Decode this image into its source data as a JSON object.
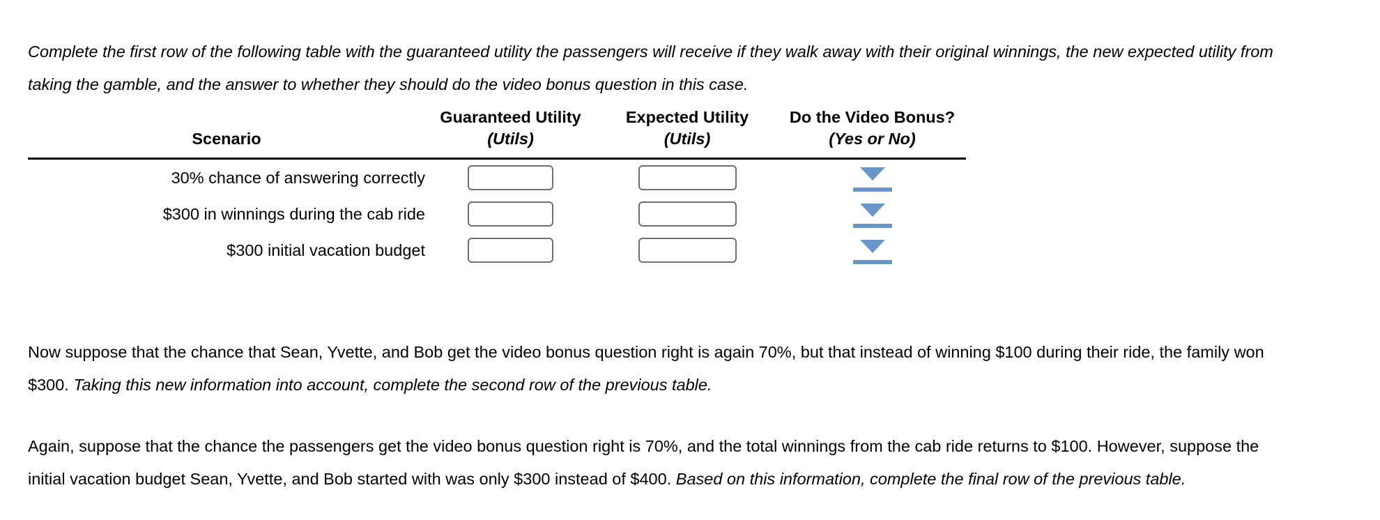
{
  "document": {
    "intro_paragraph": "Complete the first row of the following table with the guaranteed utility the passengers will receive if they walk away with their original winnings, the new expected utility from taking the gamble, and the answer to whether they should do the video bonus question in this case.",
    "paragraph_two_part1": "Now suppose that the chance that Sean, Yvette, and Bob get the video bonus question right is again 70%, but that instead of winning $100 during their ride, the family won $300. ",
    "paragraph_two_italic": "Taking this new information into account, complete the second row of the previous table.",
    "paragraph_three_part1": "Again, suppose that the chance the passengers get the video bonus question right is 70%, and the total winnings from the cab ride returns to $100. However, suppose the initial vacation budget Sean, Yvette, and Bob started with was only $300 instead of $400. ",
    "paragraph_three_italic": "Based on this information, complete the final row of the previous table."
  },
  "table": {
    "headers_top": {
      "scenario": "",
      "guaranteed_utility": "Guaranteed Utility",
      "expected_utility": "Expected Utility",
      "video_bonus": "Do the Video Bonus?"
    },
    "headers_sub": {
      "scenario": "Scenario",
      "guaranteed_utility_units": "(Utils)",
      "expected_utility_units": "(Utils)",
      "video_bonus_units": "(Yes or No)"
    },
    "rows": [
      {
        "scenario": "30% chance of answering correctly",
        "guaranteed_utility_value": "",
        "expected_utility_value": "",
        "video_bonus_selected": ""
      },
      {
        "scenario": "$300 in winnings during the cab ride",
        "guaranteed_utility_value": "",
        "expected_utility_value": "",
        "video_bonus_selected": ""
      },
      {
        "scenario": "$300 initial vacation budget",
        "guaranteed_utility_value": "",
        "expected_utility_value": "",
        "video_bonus_selected": ""
      }
    ],
    "dropdown_icon": "chevron-down-icon"
  },
  "colors": {
    "dropdown_blue": "#6a95c8",
    "input_border": "#6e6e6e",
    "rule_black": "#000000",
    "text": "#000000"
  }
}
